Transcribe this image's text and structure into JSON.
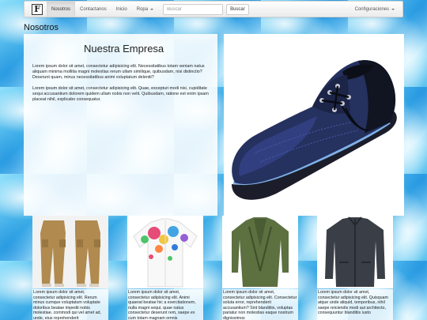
{
  "navbar": {
    "brand": "F",
    "links": [
      "Nosotros",
      "Contactanos",
      "Inicio",
      "Ropa"
    ],
    "search": {
      "placeholder": "Buscar",
      "button": "Buscar"
    },
    "right_menu": "Configuraciones"
  },
  "page": {
    "title": "Nosotros",
    "company_heading": "Nuestra Empresa",
    "paragraphs": [
      "Lorem ipsum dolor sit amet, consectetur adipisicing elit. Necessitatibus totam veniam natus aliquam minima mollitia magni molestias rerum ullam similique, quibusdam, nisi distinctio? Deserunt quam, minus necessitatibus animi voluptatum deleniti?",
      "Lorem ipsum dolor sit amet, consectetur adipisicing elit. Quae, excepturi modi nisi, cupiditate sequi accusantium dolorem quidem ullam nobis non velit. Quibusdam, ratione est enim ipsam placeat nihil, explicabo consequatur."
    ]
  },
  "products": [
    {
      "image": "pants-image",
      "text": "Lorem ipsum dolor sit amet, consectetur adipisicing elit. Rerum minus cumque voluptatum voluptate doloribus beatae impedit nobis molestiae, commodi qui vel amet ad, unde, eius reprehenderit"
    },
    {
      "image": "shirt-image",
      "text": "Lorem ipsum dolor sit amet, consectetur adipisicing elit. Animi quaerat beatae hic a exercitationem, nulla magni sequi, quae natus consectetur deserunt rem, saepe ex cum totam magnam omnis"
    },
    {
      "image": "cardigan-image",
      "text": "Lorem ipsum dolor sit amet, consectetur adipisicing elit. Consectetur soluta error, reprehenderit accusantium? Sint blanditiis, voluptas pariatur non molestias eaque nostrum dignissimos"
    },
    {
      "image": "jacket-image",
      "text": "Lorem ipsum dolor sit amet, consectetur adipisicing elit. Quisquam atque unde aliquid, temporibus, nihil saepe reiciendis modi aut architecto, consequuntur blanditiis iusto"
    }
  ]
}
